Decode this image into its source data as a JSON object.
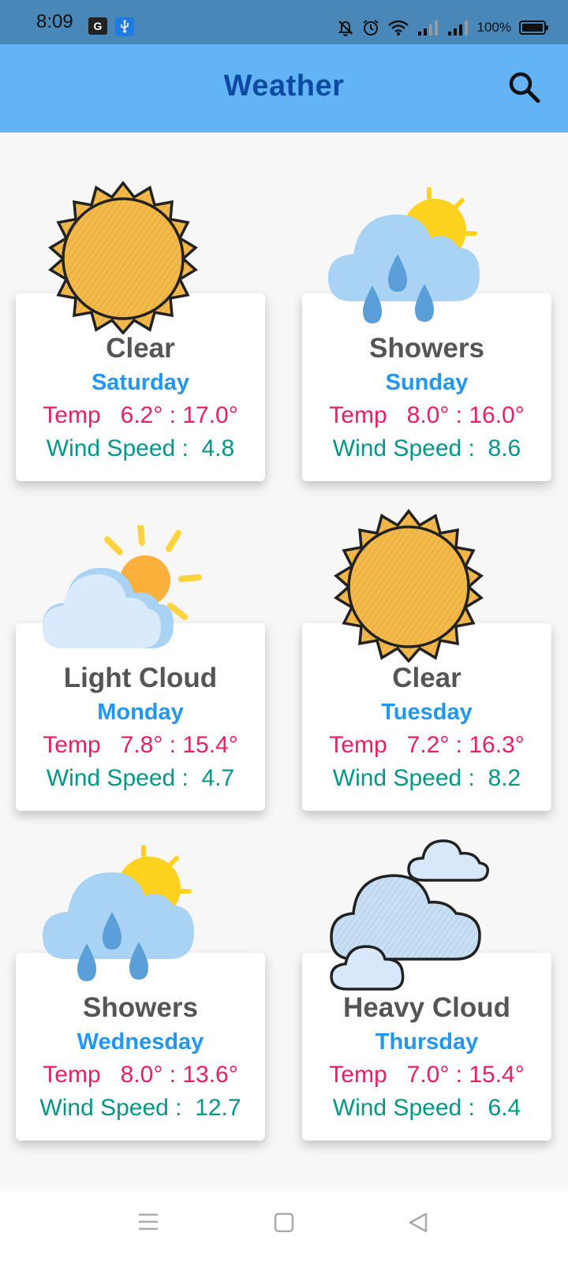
{
  "status_bar": {
    "time": "8:09",
    "translate_icon_text": "G",
    "battery_text": "100%"
  },
  "app_bar": {
    "title": "Weather",
    "search_icon": "search-icon"
  },
  "forecast": [
    {
      "condition": "Clear",
      "day": "Saturday",
      "temp_label": "Temp",
      "temp_range": "6.2° : 17.0°",
      "wind_label": "Wind Speed :",
      "wind_speed": "4.8",
      "icon": "sun-icon"
    },
    {
      "condition": "Showers",
      "day": "Sunday",
      "temp_label": "Temp",
      "temp_range": "8.0° : 16.0°",
      "wind_label": "Wind Speed :",
      "wind_speed": "8.6",
      "icon": "showers-icon"
    },
    {
      "condition": "Light Cloud",
      "day": "Monday",
      "temp_label": "Temp",
      "temp_range": "7.8° : 15.4°",
      "wind_label": "Wind Speed :",
      "wind_speed": "4.7",
      "icon": "light-cloud-icon"
    },
    {
      "condition": "Clear",
      "day": "Tuesday",
      "temp_label": "Temp",
      "temp_range": "7.2° : 16.3°",
      "wind_label": "Wind Speed :",
      "wind_speed": "8.2",
      "icon": "sun-icon"
    },
    {
      "condition": "Showers",
      "day": "Wednesday",
      "temp_label": "Temp",
      "temp_range": "8.0° : 13.6°",
      "wind_label": "Wind Speed :",
      "wind_speed": "12.7",
      "icon": "showers-icon"
    },
    {
      "condition": "Heavy Cloud",
      "day": "Thursday",
      "temp_label": "Temp",
      "temp_range": "7.0° : 15.4°",
      "wind_label": "Wind Speed :",
      "wind_speed": "6.4",
      "icon": "heavy-cloud-icon"
    }
  ],
  "colors": {
    "status_bar": "#4a87b9",
    "app_bar": "#63b4f6",
    "title": "#0e4aa4",
    "condition": "#555555",
    "day": "#2196f3",
    "temp": "#e91e63",
    "wind": "#009688"
  },
  "nav_bar": {
    "icons": [
      "menu-icon",
      "home-square-icon",
      "back-triangle-icon"
    ]
  }
}
